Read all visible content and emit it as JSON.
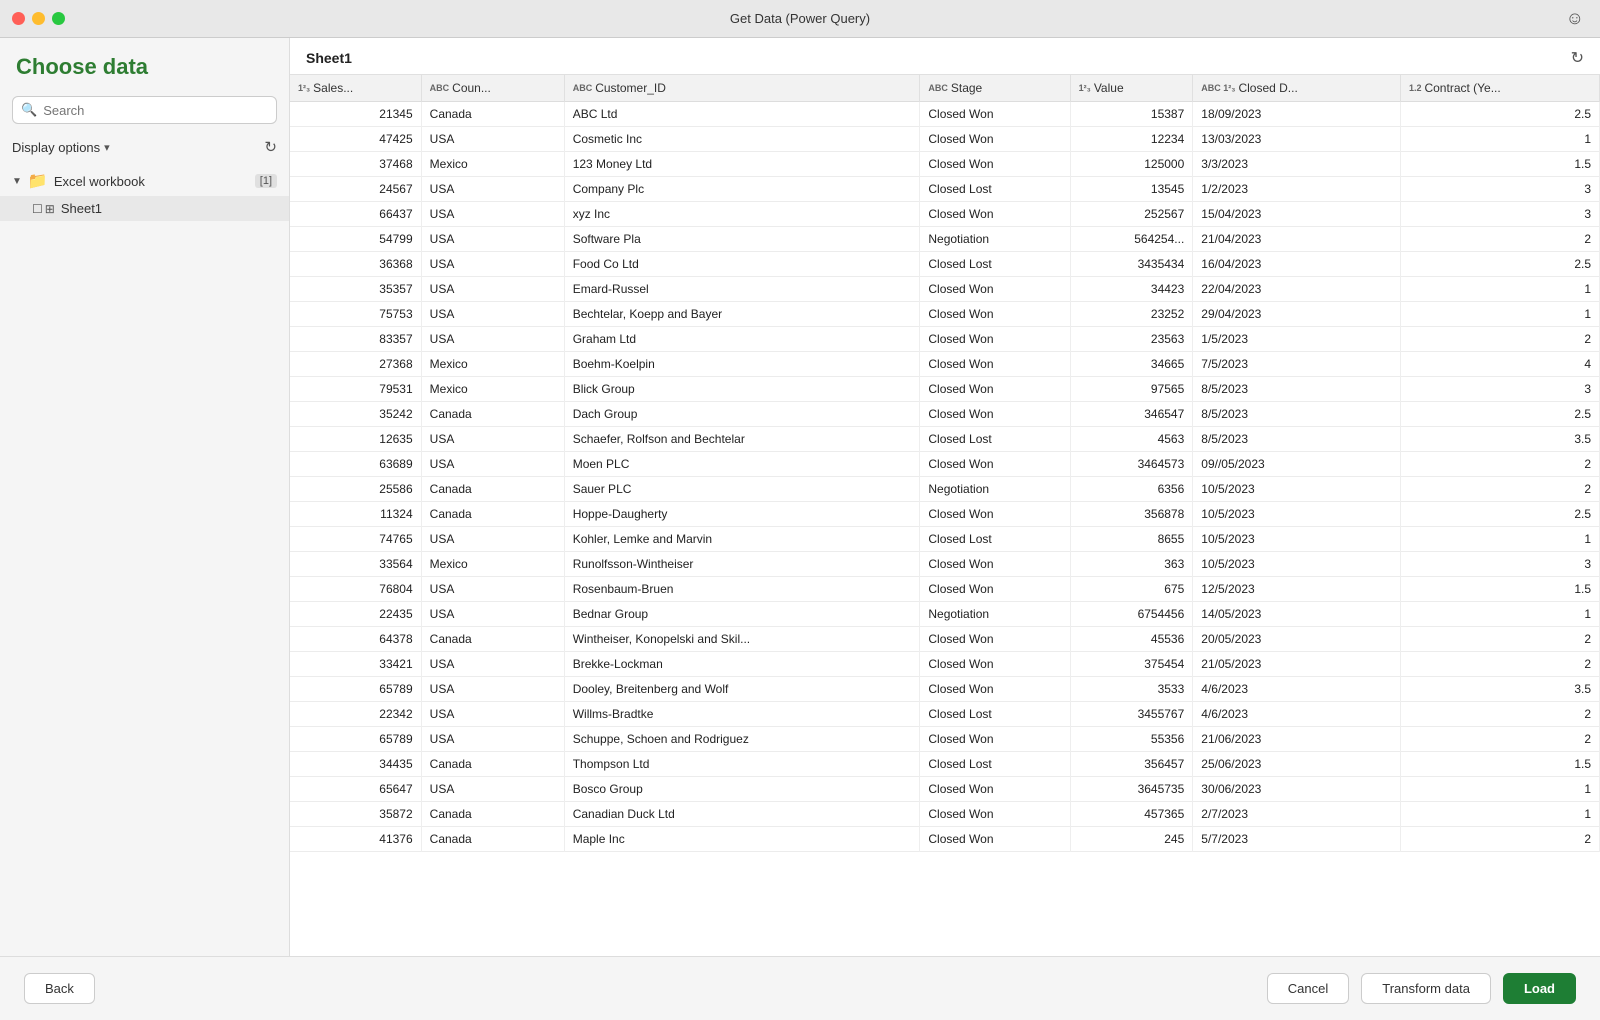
{
  "window": {
    "title": "Get Data (Power Query)"
  },
  "sidebar": {
    "title": "Choose data",
    "search_placeholder": "Search",
    "display_options_label": "Display options",
    "workbook_label": "Excel workbook",
    "workbook_count": "[1]",
    "sheet_label": "Sheet1"
  },
  "content": {
    "sheet_name": "Sheet1",
    "columns": [
      {
        "label": "Sales...",
        "type": "1²₃"
      },
      {
        "label": "Coun...",
        "type": "ABC"
      },
      {
        "label": "Customer_ID",
        "type": "ABC"
      },
      {
        "label": "Stage",
        "type": "ABC"
      },
      {
        "label": "Value",
        "type": "1²₃"
      },
      {
        "label": "Closed D...",
        "type": "ABC 1²₃"
      },
      {
        "label": "Contract (Ye...",
        "type": "1.2"
      }
    ],
    "rows": [
      [
        "21345",
        "Canada",
        "ABC Ltd",
        "Closed Won",
        "15387",
        "18/09/2023",
        "2.5"
      ],
      [
        "47425",
        "USA",
        "Cosmetic Inc",
        "Closed Won",
        "12234",
        "13/03/2023",
        "1"
      ],
      [
        "37468",
        "Mexico",
        "123 Money Ltd",
        "Closed Won",
        "125000",
        "3/3/2023",
        "1.5"
      ],
      [
        "24567",
        "USA",
        "Company Plc",
        "Closed Lost",
        "13545",
        "1/2/2023",
        "3"
      ],
      [
        "66437",
        "USA",
        "xyz Inc",
        "Closed Won",
        "252567",
        "15/04/2023",
        "3"
      ],
      [
        "54799",
        "USA",
        "Software Pla",
        "Negotiation",
        "564254...",
        "21/04/2023",
        "2"
      ],
      [
        "36368",
        "USA",
        "Food Co Ltd",
        "Closed Lost",
        "3435434",
        "16/04/2023",
        "2.5"
      ],
      [
        "35357",
        "USA",
        "Emard-Russel",
        "Closed Won",
        "34423",
        "22/04/2023",
        "1"
      ],
      [
        "75753",
        "USA",
        "Bechtelar, Koepp and Bayer",
        "Closed Won",
        "23252",
        "29/04/2023",
        "1"
      ],
      [
        "83357",
        "USA",
        "Graham Ltd",
        "Closed Won",
        "23563",
        "1/5/2023",
        "2"
      ],
      [
        "27368",
        "Mexico",
        "Boehm-Koelpin",
        "Closed Won",
        "34665",
        "7/5/2023",
        "4"
      ],
      [
        "79531",
        "Mexico",
        "Blick Group",
        "Closed Won",
        "97565",
        "8/5/2023",
        "3"
      ],
      [
        "35242",
        "Canada",
        "Dach Group",
        "Closed Won",
        "346547",
        "8/5/2023",
        "2.5"
      ],
      [
        "12635",
        "USA",
        "Schaefer, Rolfson and Bechtelar",
        "Closed Lost",
        "4563",
        "8/5/2023",
        "3.5"
      ],
      [
        "63689",
        "USA",
        "Moen PLC",
        "Closed Won",
        "3464573",
        "09//05/2023",
        "2"
      ],
      [
        "25586",
        "Canada",
        "Sauer PLC",
        "Negotiation",
        "6356",
        "10/5/2023",
        "2"
      ],
      [
        "11324",
        "Canada",
        "Hoppe-Daugherty",
        "Closed Won",
        "356878",
        "10/5/2023",
        "2.5"
      ],
      [
        "74765",
        "USA",
        "Kohler, Lemke and Marvin",
        "Closed Lost",
        "8655",
        "10/5/2023",
        "1"
      ],
      [
        "33564",
        "Mexico",
        "Runolfsson-Wintheiser",
        "Closed Won",
        "363",
        "10/5/2023",
        "3"
      ],
      [
        "76804",
        "USA",
        "Rosenbaum-Bruen",
        "Closed Won",
        "675",
        "12/5/2023",
        "1.5"
      ],
      [
        "22435",
        "USA",
        "Bednar Group",
        "Negotiation",
        "6754456",
        "14/05/2023",
        "1"
      ],
      [
        "64378",
        "Canada",
        "Wintheiser, Konopelski and Skil...",
        "Closed Won",
        "45536",
        "20/05/2023",
        "2"
      ],
      [
        "33421",
        "USA",
        "Brekke-Lockman",
        "Closed Won",
        "375454",
        "21/05/2023",
        "2"
      ],
      [
        "65789",
        "USA",
        "Dooley, Breitenberg and Wolf",
        "Closed Won",
        "3533",
        "4/6/2023",
        "3.5"
      ],
      [
        "22342",
        "USA",
        "Willms-Bradtke",
        "Closed Lost",
        "3455767",
        "4/6/2023",
        "2"
      ],
      [
        "65789",
        "USA",
        "Schuppe, Schoen and Rodriguez",
        "Closed Won",
        "55356",
        "21/06/2023",
        "2"
      ],
      [
        "34435",
        "Canada",
        "Thompson Ltd",
        "Closed Lost",
        "356457",
        "25/06/2023",
        "1.5"
      ],
      [
        "65647",
        "USA",
        "Bosco Group",
        "Closed Won",
        "3645735",
        "30/06/2023",
        "1"
      ],
      [
        "35872",
        "Canada",
        "Canadian Duck Ltd",
        "Closed Won",
        "457365",
        "2/7/2023",
        "1"
      ],
      [
        "41376",
        "Canada",
        "Maple Inc",
        "Closed Won",
        "245",
        "5/7/2023",
        "2"
      ]
    ]
  },
  "footer": {
    "back_label": "Back",
    "cancel_label": "Cancel",
    "transform_label": "Transform data",
    "load_label": "Load"
  }
}
